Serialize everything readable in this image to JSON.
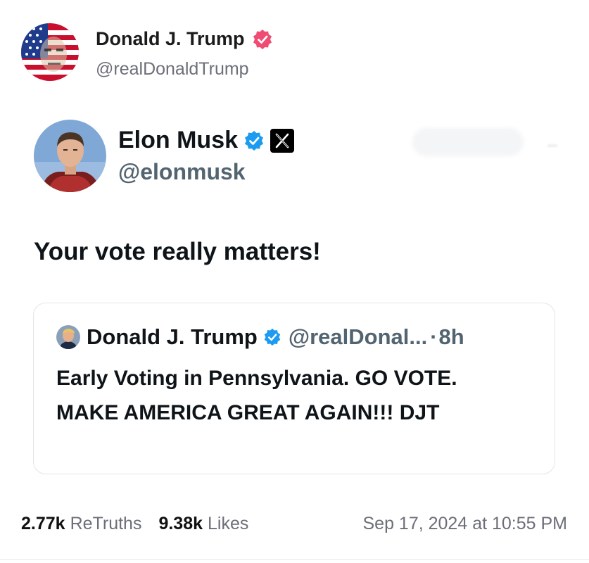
{
  "truth_post": {
    "author_name": "Donald J. Trump",
    "author_handle": "@realDonaldTrump",
    "verified_icon": "pink-verified-badge-icon",
    "verified_color": "#ef4b73"
  },
  "x_post": {
    "author_name": "Elon Musk",
    "author_handle": "@elonmusk",
    "verified_icon": "blue-verified-badge-icon",
    "verified_color": "#1d9bf0",
    "platform_icon": "x-logo-icon",
    "text": "Your vote really matters!",
    "quoted_post": {
      "author_name": "Donald J. Trump",
      "author_handle": "@realDonal...",
      "separator": "·",
      "time": "8h",
      "text": "Early Voting in Pennsylvania. GO VOTE. MAKE AMERICA GREAT AGAIN!!! DJT"
    }
  },
  "stats": {
    "retruths_count": "2.77k",
    "retruths_label": "ReTruths",
    "likes_count": "9.38k",
    "likes_label": "Likes",
    "timestamp": "Sep 17, 2024 at 10:55 PM"
  }
}
